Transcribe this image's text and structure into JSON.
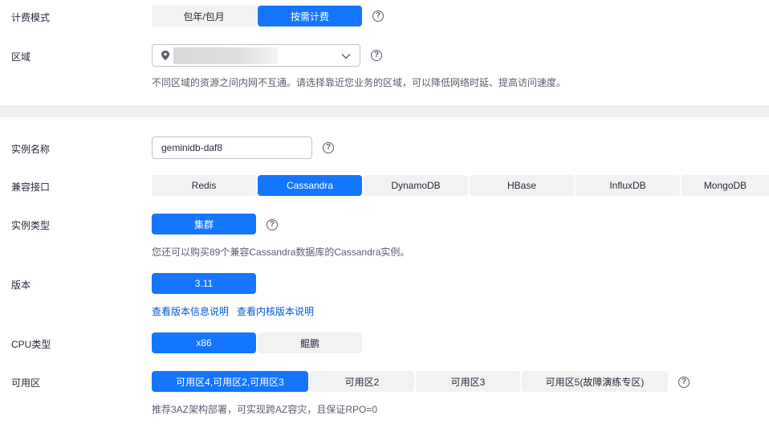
{
  "billing": {
    "label": "计费模式",
    "options": [
      "包年/包月",
      "按需计费"
    ],
    "selected": "按需计费"
  },
  "region": {
    "label": "区域",
    "hint": "不同区域的资源之间内网不互通。请选择靠近您业务的区域，可以降低网络时延、提高访问速度。"
  },
  "instance_name": {
    "label": "实例名称",
    "value": "geminidb-daf8"
  },
  "compat": {
    "label": "兼容接口",
    "options": [
      "Redis",
      "Cassandra",
      "DynamoDB",
      "HBase",
      "InfluxDB",
      "MongoDB"
    ],
    "selected": "Cassandra"
  },
  "instance_type": {
    "label": "实例类型",
    "options": [
      "集群"
    ],
    "hint": "您还可以购买89个兼容Cassandra数据库的Cassandra实例。"
  },
  "version": {
    "label": "版本",
    "options": [
      "3.11"
    ],
    "links": [
      "查看版本信息说明",
      "查看内核版本说明"
    ]
  },
  "cpu": {
    "label": "CPU类型",
    "options": [
      "x86",
      "鲲鹏"
    ],
    "selected": "x86"
  },
  "az": {
    "label": "可用区",
    "options": [
      "可用区4,可用区2,可用区3",
      "可用区2",
      "可用区3",
      "可用区5(故障演练专区)"
    ],
    "selected": "可用区4,可用区2,可用区3",
    "hint": "推荐3AZ架构部署，可实现跨AZ容灾，且保证RPO=0"
  },
  "help_symbol": "?",
  "colors": {
    "accent": "#1476ff",
    "link": "#0056d6"
  }
}
